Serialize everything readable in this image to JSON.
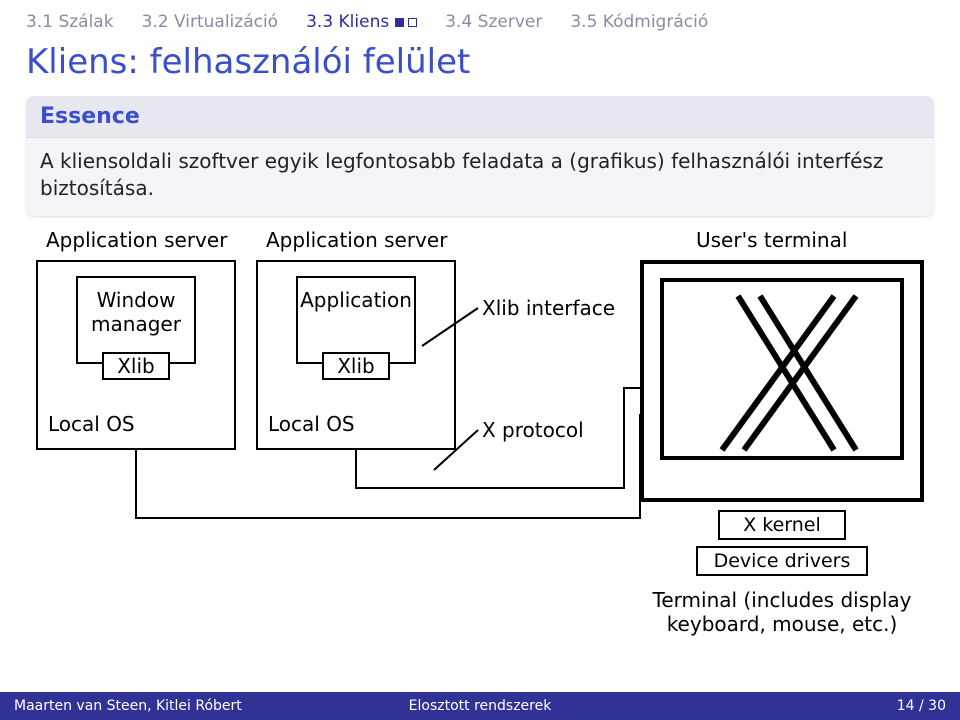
{
  "tabs": {
    "t1": "3.1 Szálak",
    "t2": "3.2 Virtualizáció",
    "t3": "3.3 Kliens",
    "t4": "3.4 Szerver",
    "t5": "3.5 Kódmigráció"
  },
  "title": "Kliens: felhasználói felület",
  "essence": {
    "heading": "Essence",
    "body": "A kliensoldali szoftver egyik legfontosabb feladata a (grafikus) felhasználói interfész biztosítása."
  },
  "diagram": {
    "label_appserver1": "Application server",
    "label_appserver2": "Application server",
    "label_userterm": "User's terminal",
    "window_manager": "Window\nmanager",
    "application": "Application",
    "xlib1": "Xlib",
    "xlib2": "Xlib",
    "localos1": "Local OS",
    "localos2": "Local OS",
    "xlib_interface": "Xlib interface",
    "x_protocol": "X protocol",
    "x_kernel": "X kernel",
    "device_drivers": "Device drivers",
    "terminal_caption": "Terminal (includes display\nkeyboard, mouse, etc.)"
  },
  "footer": {
    "left": "Maarten van Steen, Kitlei Róbert",
    "center": "Elosztott rendszerek",
    "right": "14 / 30"
  }
}
